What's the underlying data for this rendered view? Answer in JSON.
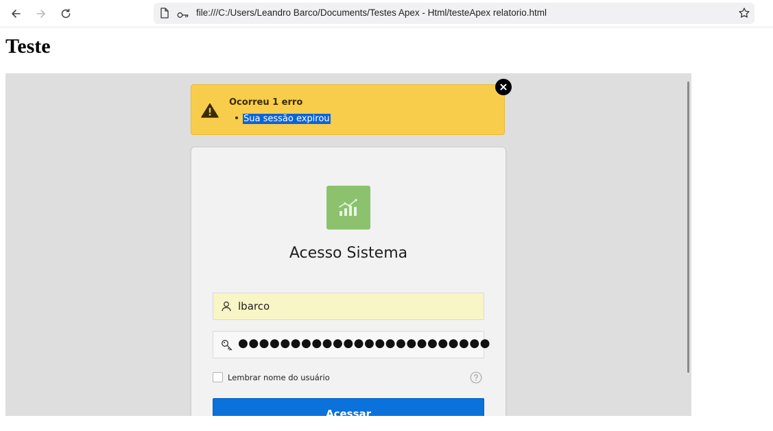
{
  "browser": {
    "address": "file:///C:/Users/Leandro Barco/Documents/Testes Apex - Html/testeApex relatorio.html"
  },
  "page": {
    "heading": "Teste"
  },
  "alert": {
    "title": "Ocorreu 1 erro",
    "messages": [
      "Sua sessão expirou"
    ],
    "color": "#f8cd4b"
  },
  "login": {
    "title": "Acesso Sistema",
    "username_value": "lbarco",
    "password_masked": "●●●●●●●●●●●●●●●●●●●●●●●●",
    "remember_label": "Lembrar nome do usuário",
    "remember_checked": false,
    "submit_label": "Acessar",
    "accent_color": "#0a72da",
    "logo_color": "#8cc26e",
    "icons": [
      "user-icon",
      "key-icon",
      "help-icon",
      "chart-logo-icon"
    ]
  }
}
